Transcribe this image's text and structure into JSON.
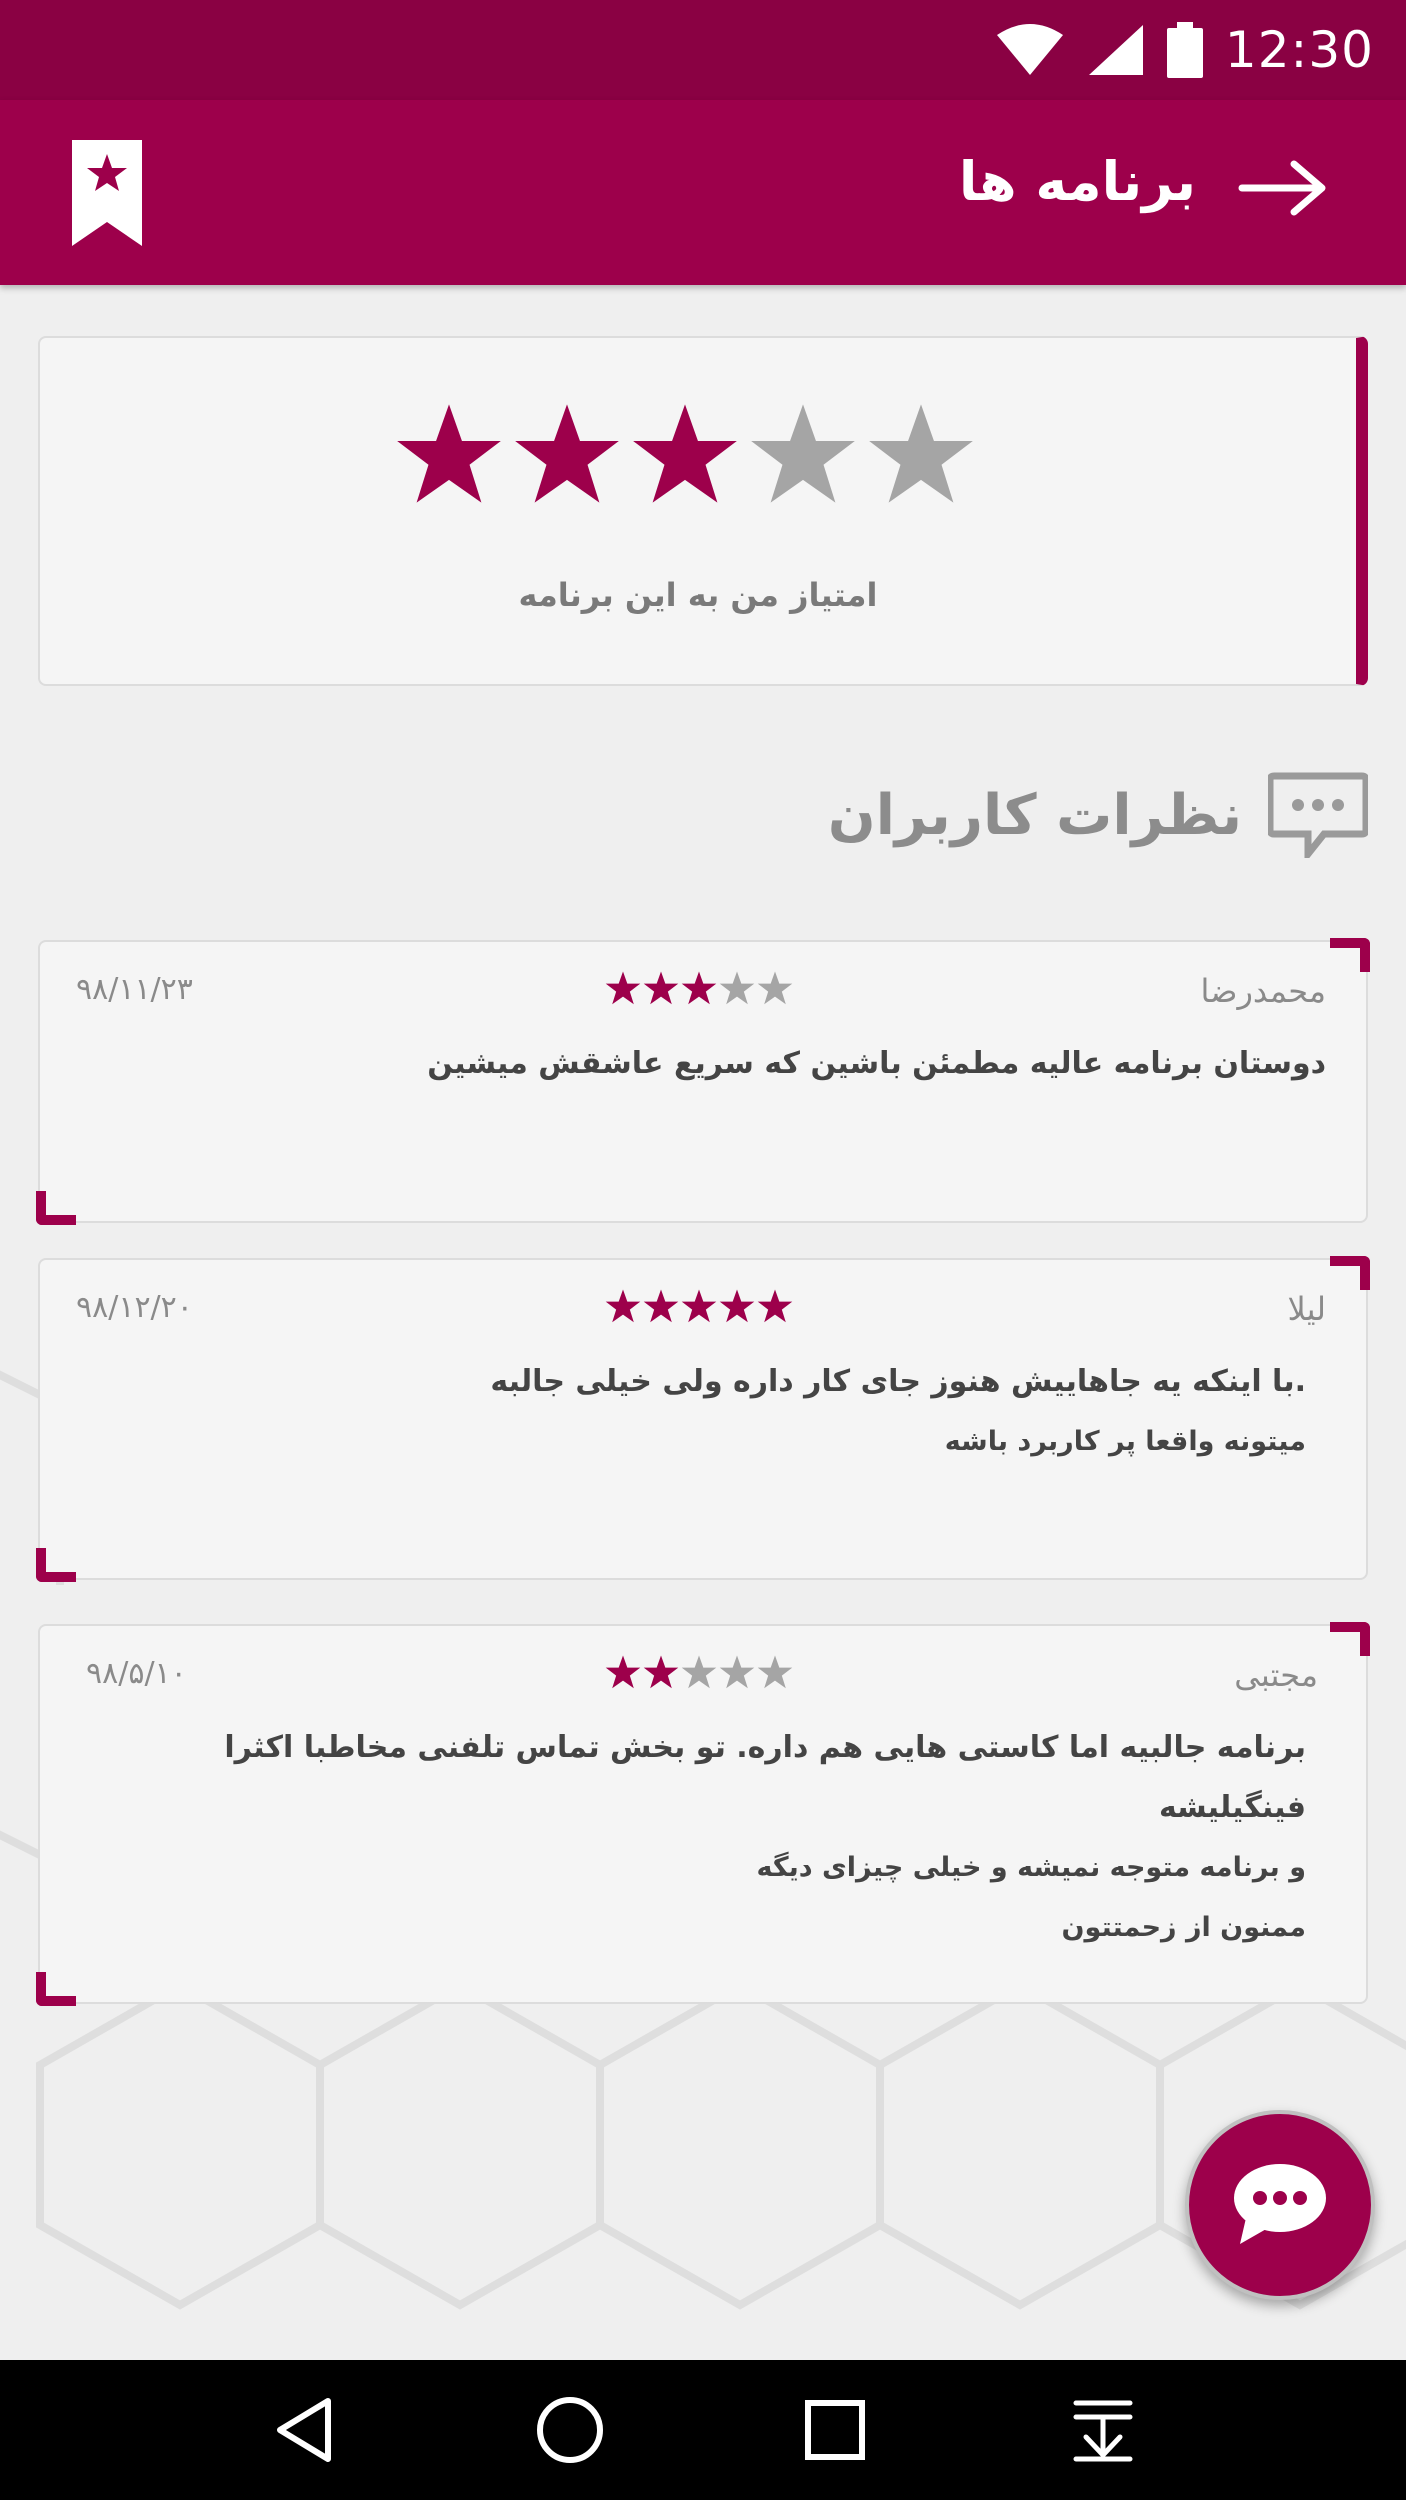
{
  "status_bar": {
    "time": "12:30"
  },
  "app_bar": {
    "title": "برنامه ها"
  },
  "my_rating": {
    "label": "امتیاز من به این برنامه",
    "value": 3,
    "max": 5
  },
  "reviews_section": {
    "title": "نظرات کاربران"
  },
  "reviews": [
    {
      "name": "محمدرضا",
      "date": "۹۸/۱۱/۲۳",
      "rating": 3,
      "lines": [
        "دوستان برنامه عالیه مطمئن باشین که سریع عاشقش میشین"
      ]
    },
    {
      "name": "لیلا",
      "date": "۹۸/۱۲/۲۰",
      "rating": 5,
      "lines": [
        ".با اینکه یه جاهاییش هنوز جای کار داره ولی خیلی جالبه",
        "میتونه واقعا پر کاربرد باشه"
      ]
    },
    {
      "name": "مجتبی",
      "date": "۹۸/۵/۱۰",
      "rating": 2,
      "lines": [
        "برنامه جالبیه اما کاستی هایی هم داره. تو بخش تماس تلفنی مخاطبا اکثرا فینگیلیشه",
        "و برنامه متوجه نمیشه و خیلی چیزای دیگه",
        "ممنون از زحمتتون"
      ]
    }
  ],
  "colors": {
    "primary": "#9d004b",
    "status": "#8a0143",
    "star_off": "#a5a5a5"
  },
  "icons": {
    "bookmark": "bookmark-star-icon",
    "back": "arrow-right-icon",
    "comments": "chat-bubble-icon",
    "fab": "chat-bubble-icon",
    "nav": [
      "back-triangle-icon",
      "home-circle-icon",
      "recents-square-icon",
      "download-icon"
    ]
  }
}
